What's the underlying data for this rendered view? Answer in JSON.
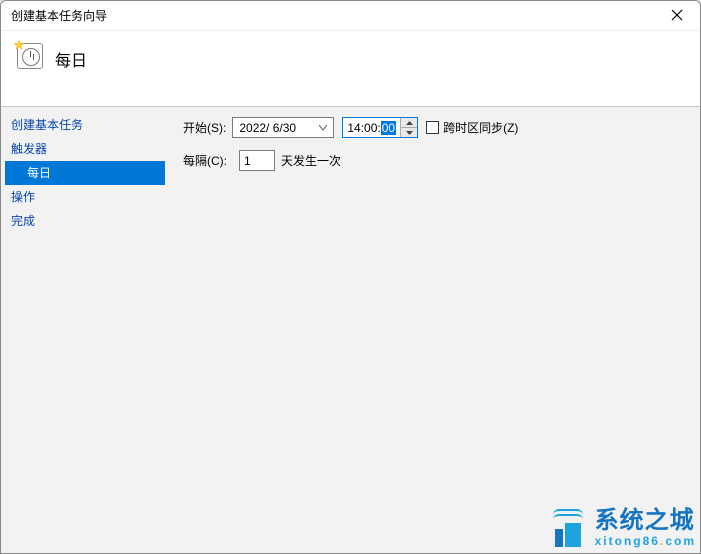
{
  "window": {
    "title": "创建基本任务向导"
  },
  "header": {
    "title": "每日"
  },
  "sidebar": {
    "items": [
      {
        "label": "创建基本任务",
        "type": "link",
        "selected": false
      },
      {
        "label": "触发器",
        "type": "link",
        "selected": false
      },
      {
        "label": "每日",
        "type": "sub",
        "selected": true
      },
      {
        "label": "操作",
        "type": "link",
        "selected": false
      },
      {
        "label": "完成",
        "type": "link",
        "selected": false
      }
    ]
  },
  "content": {
    "start_label": "开始(S):",
    "date_value": "2022/ 6/30",
    "time_hour_min": "14:00:",
    "time_sec_selected": "00",
    "sync_tz_label": "跨时区同步(Z)",
    "sync_tz_checked": false,
    "recur_label": "每隔(C):",
    "recur_value": "1",
    "recur_suffix": "天发生一次"
  },
  "watermark": {
    "cn": "系统之城",
    "url_pre": "xitong86",
    "url_dot1": ".",
    "url_mid": "com"
  }
}
